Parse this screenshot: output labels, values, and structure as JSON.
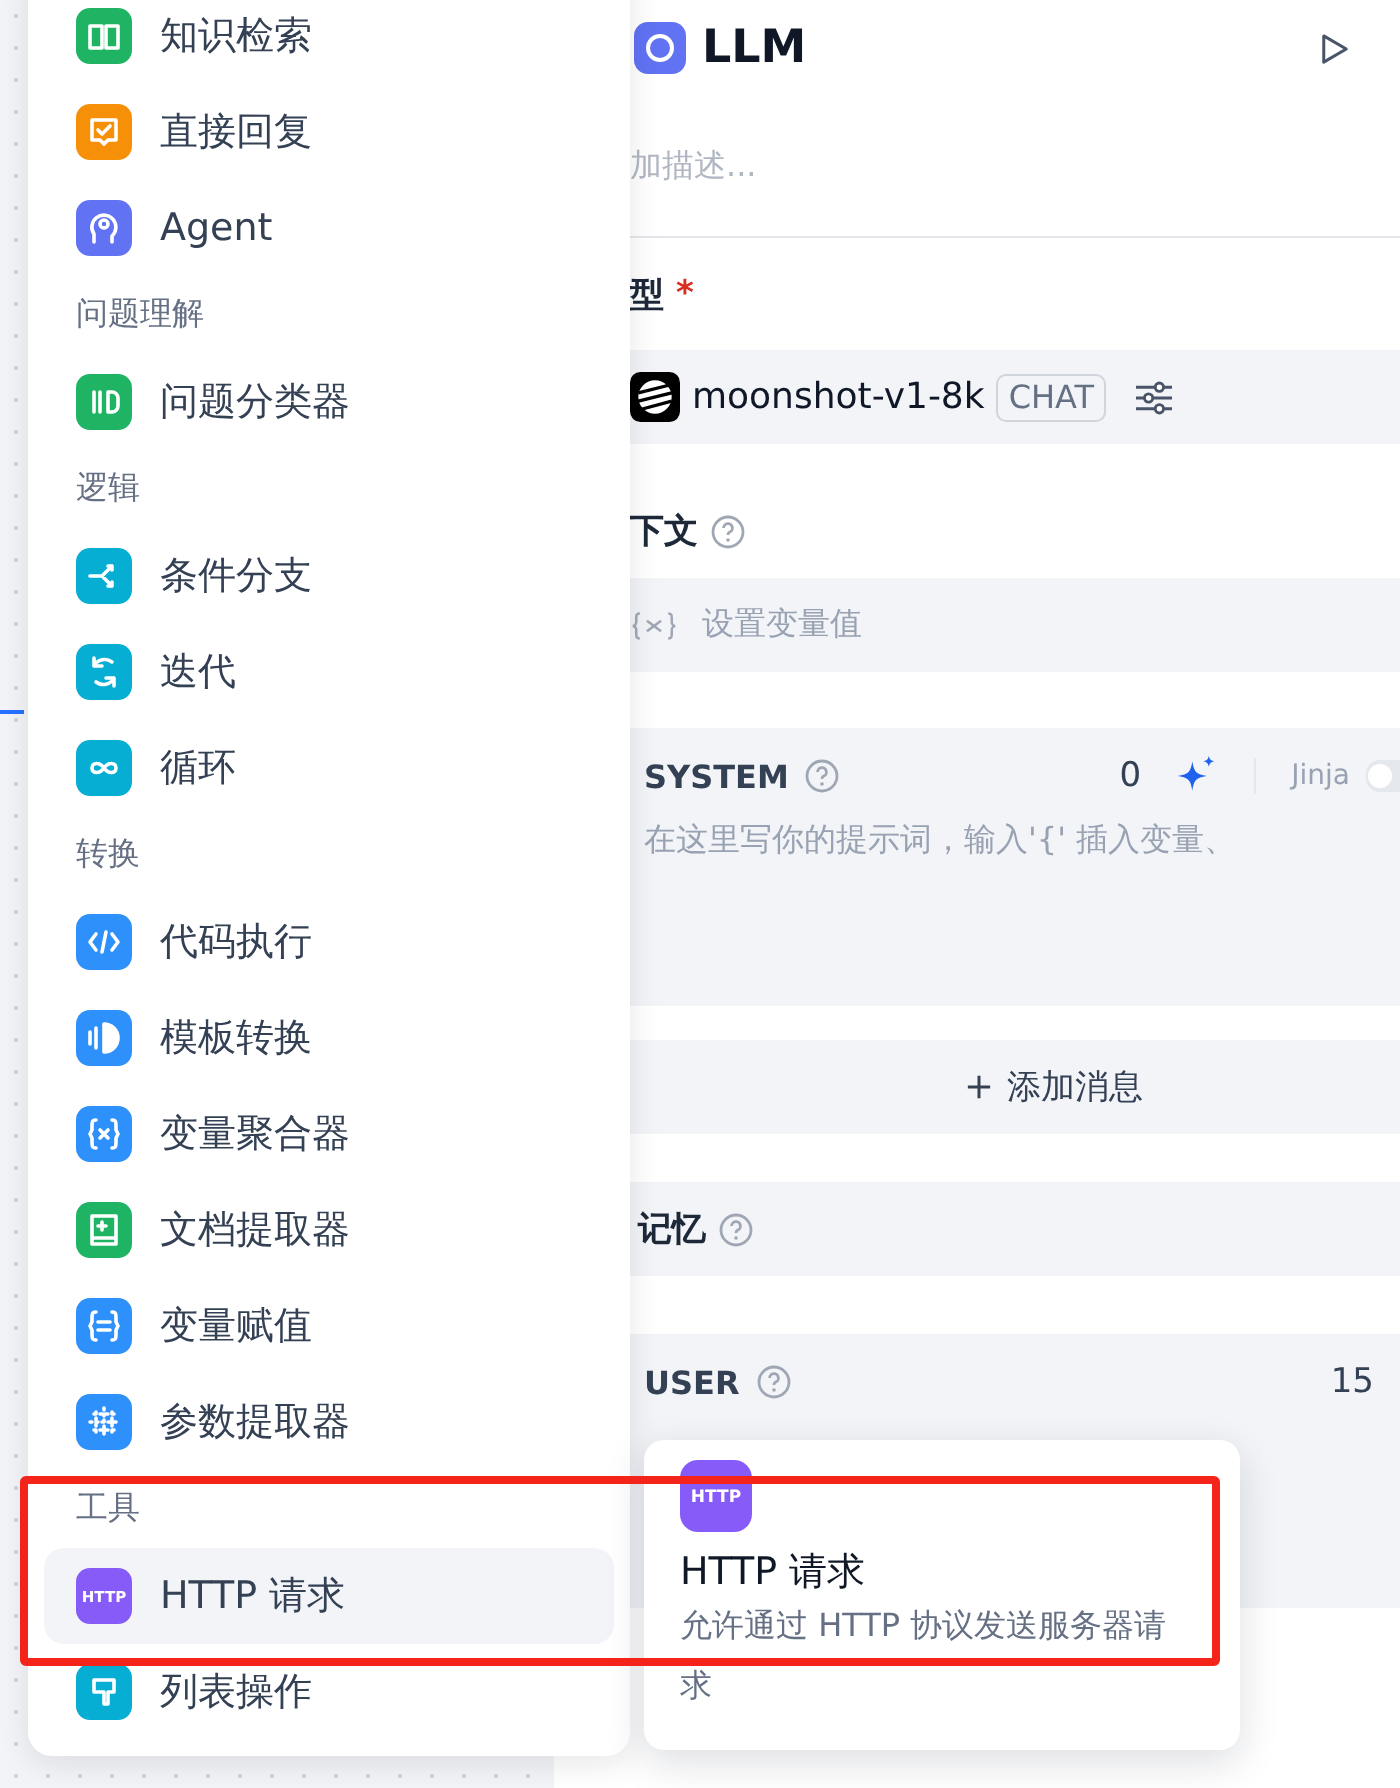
{
  "node_menu": {
    "sections": [
      {
        "items": [
          {
            "label": "知识检索",
            "kind": "book",
            "color": "#1fb464",
            "selected": false
          },
          {
            "label": "直接回复",
            "kind": "reply",
            "color": "#f79009",
            "selected": false
          },
          {
            "label": "Agent",
            "kind": "agent",
            "color": "#6172f3",
            "selected": false
          }
        ]
      },
      {
        "title": "问题理解",
        "items": [
          {
            "label": "问题分类器",
            "kind": "classifier",
            "color": "#1fb464",
            "selected": false
          }
        ]
      },
      {
        "title": "逻辑",
        "items": [
          {
            "label": "条件分支",
            "kind": "branch",
            "color": "#06aed4",
            "selected": false
          },
          {
            "label": "迭代",
            "kind": "iterate",
            "color": "#06aed4",
            "selected": false
          },
          {
            "label": "循环",
            "kind": "loop",
            "color": "#06aed4",
            "selected": false
          }
        ]
      },
      {
        "title": "转换",
        "items": [
          {
            "label": "代码执行",
            "kind": "code",
            "color": "#2e90fa",
            "selected": false
          },
          {
            "label": "模板转换",
            "kind": "template",
            "color": "#2e90fa",
            "selected": false
          },
          {
            "label": "变量聚合器",
            "kind": "aggregator",
            "color": "#2e90fa",
            "selected": false
          },
          {
            "label": "文档提取器",
            "kind": "doc",
            "color": "#1fb464",
            "selected": false
          },
          {
            "label": "变量赋值",
            "kind": "assign",
            "color": "#2e90fa",
            "selected": false
          },
          {
            "label": "参数提取器",
            "kind": "params",
            "color": "#2e90fa",
            "selected": false
          }
        ]
      },
      {
        "title": "工具",
        "items": [
          {
            "label": "HTTP 请求",
            "kind": "http",
            "icon_text": "HTTP",
            "color": "#875bf7",
            "selected": true
          },
          {
            "label": "列表操作",
            "kind": "list",
            "color": "#06aed4",
            "selected": false
          }
        ]
      }
    ]
  },
  "panel": {
    "title": "LLM",
    "description_placeholder": "加描述...",
    "model_label": "型",
    "required_mark": "*",
    "model_name": "moonshot-v1-8k",
    "model_badge": "CHAT",
    "context_label": "下文",
    "variable_placeholder": "设置变量值",
    "system": {
      "role": "SYSTEM",
      "count": "0",
      "jinja_label": "Jinja",
      "jinja_on": false,
      "placeholder": "在这里写你的提示词，输入'{' 插入变量、"
    },
    "add_message": "添加消息",
    "memory_label": "记忆",
    "user": {
      "role": "USER",
      "count": "15"
    }
  },
  "tooltip": {
    "icon_text": "HTTP",
    "title": "HTTP 请求",
    "description": "允许通过 HTTP 协议发送服务器请求"
  }
}
